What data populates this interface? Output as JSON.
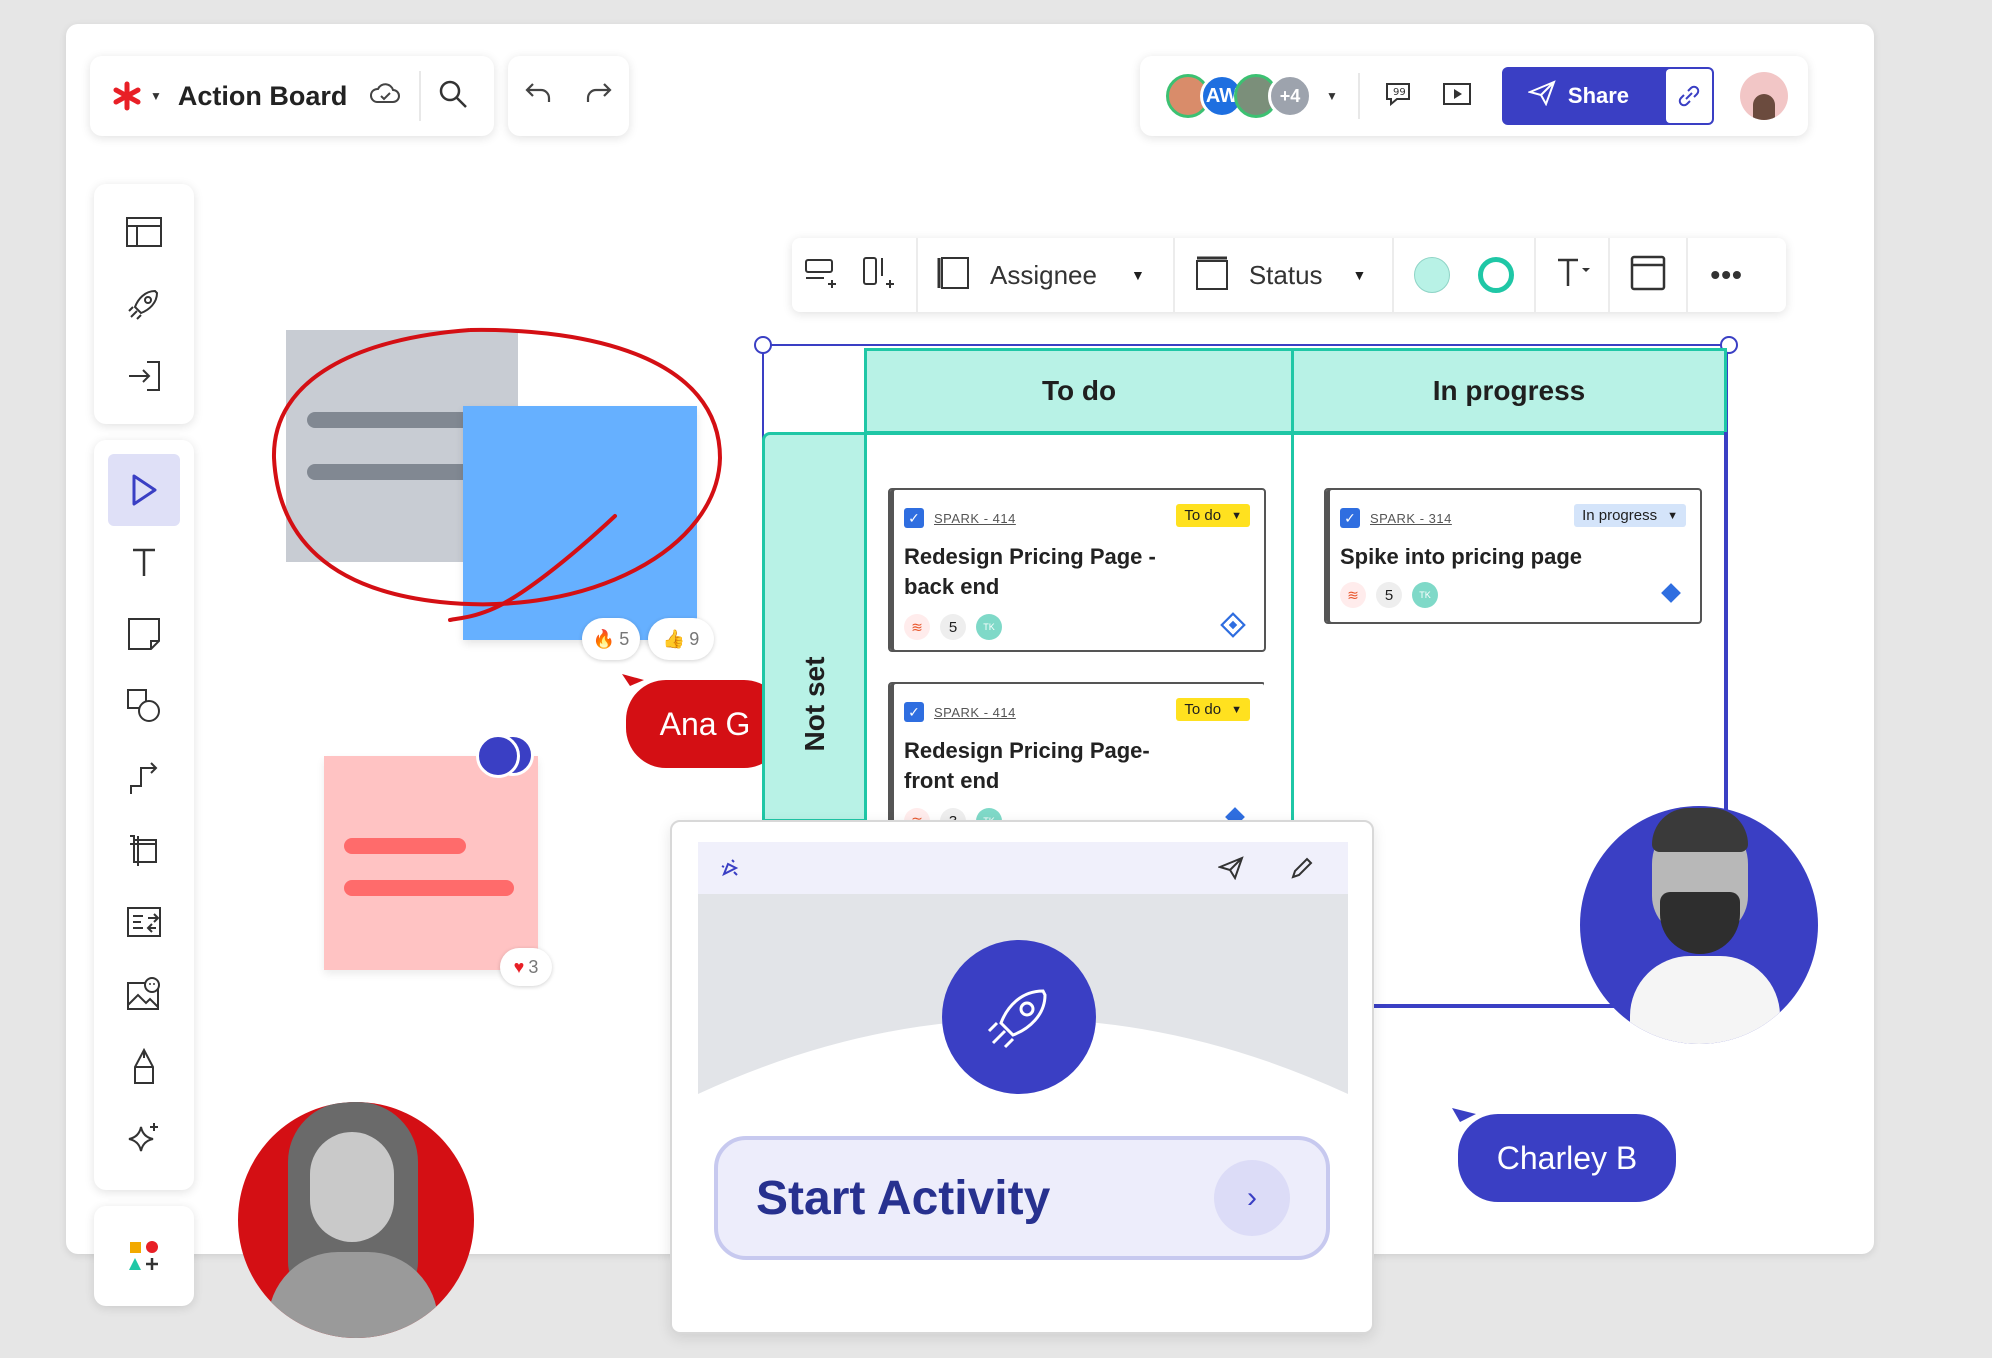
{
  "app": {
    "title": "Action Board"
  },
  "toolbar_top": {
    "share_label": "Share",
    "extra_collaborators": "+4",
    "collaborator_initials": "AW"
  },
  "board_toolbar": {
    "assignee_label": "Assignee",
    "status_label": "Status"
  },
  "board": {
    "columns": [
      "To do",
      "In progress"
    ],
    "row_label": "Not set",
    "cards": [
      {
        "tag": "SPARK - 414",
        "status": "To do",
        "title_line1": "Redesign Pricing Page -",
        "title_line2": "back end",
        "points": "5",
        "assignee": "TK"
      },
      {
        "tag": "SPARK - 414",
        "status": "To do",
        "title_line1": "Redesign Pricing Page-",
        "title_line2": "front end",
        "points": "3",
        "assignee": "TK"
      },
      {
        "tag": "SPARK - 314",
        "status": "In progress",
        "title_line1": "Spike into pricing page",
        "title_line2": "",
        "points": "5",
        "assignee": "TK"
      }
    ]
  },
  "reactions": {
    "fire_count": "5",
    "thumbs_count": "9",
    "heart_count": "3"
  },
  "cursors": {
    "user1": "Ana G",
    "user2": "Charley B"
  },
  "activity": {
    "button_label": "Start Activity"
  },
  "colors": {
    "accent": "#3a3fc4",
    "red": "#d40f14",
    "teal": "#b8f2e6",
    "teal_border": "#1fc7a6",
    "sticky_blue": "#66b0ff",
    "sticky_pink": "#ffc3c3",
    "sticky_gray": "#c8ccd3"
  }
}
